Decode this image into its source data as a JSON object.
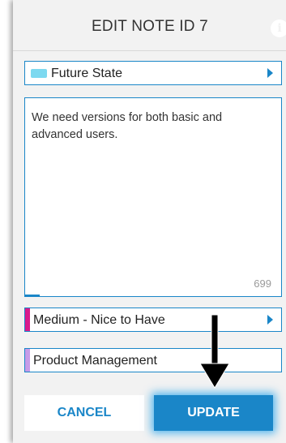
{
  "header": {
    "title": "EDIT NOTE ID 7",
    "info_icon": "info-icon"
  },
  "category": {
    "label": "Future State",
    "color": "#7dd9f0"
  },
  "note": {
    "text": "We need versions for both basic and advanced users.",
    "chars_remaining": "699"
  },
  "priority": {
    "label": "Medium - Nice to Have",
    "color": "#d81b8c"
  },
  "team": {
    "label": "Product Management",
    "color": "#c79be8"
  },
  "buttons": {
    "cancel_label": "CANCEL",
    "update_label": "UPDATE"
  },
  "colors": {
    "accent": "#1a86c8",
    "panel_bg": "#f2f2f2"
  }
}
